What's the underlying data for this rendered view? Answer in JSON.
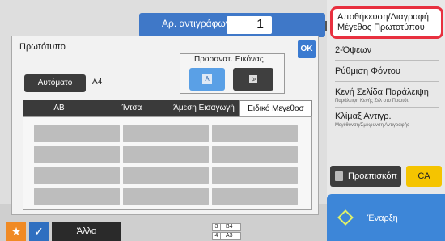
{
  "copies": {
    "label": "Αρ. αντιγράφων",
    "value": "1"
  },
  "dialog": {
    "title": "Πρωτότυπο",
    "ok_label": "OK",
    "orientation": {
      "title": "Προσανατ. Εικόνας",
      "option_a": "A",
      "option_b": "A"
    },
    "auto_label": "Αυτόματο",
    "size_value": "A4",
    "tabs": [
      {
        "label": "AB"
      },
      {
        "label": "Ίντσα"
      },
      {
        "label": "Άμεση Εισαγωγή"
      },
      {
        "label": "Ειδικό Μεγεθοσ"
      }
    ]
  },
  "side_menu": {
    "highlighted": {
      "line1": "Αποθήκευση/Διαγραφή",
      "line2": "Μέγεθος Πρωτοτύπου"
    },
    "items": [
      {
        "main": "2-Όψεων",
        "sub": ""
      },
      {
        "main": "Ρύθμιση Φόντου",
        "sub": ""
      },
      {
        "main": "Κενή Σελίδα Παράλειψη",
        "sub": "Παράλειψη Κενής Σελ στο Πρωτότ"
      },
      {
        "main": "Κλίμαξ Αντιγρ.",
        "sub": "Μεγέθυνση/Σμίκρυνση Αντιγραφής"
      }
    ]
  },
  "buttons": {
    "preview": "Προεπισκόπ",
    "ca": "CA",
    "start": "Έναρξη",
    "other": "Άλλα"
  },
  "trays": [
    {
      "num": "3",
      "size": "B4"
    },
    {
      "num": "4",
      "size": "A3"
    }
  ],
  "colors": {
    "accent_blue": "#3f78c8",
    "highlight_red": "#e8303f",
    "ca_yellow": "#f5c400",
    "start_blue": "#3d86d8",
    "star_orange": "#f08a24"
  }
}
